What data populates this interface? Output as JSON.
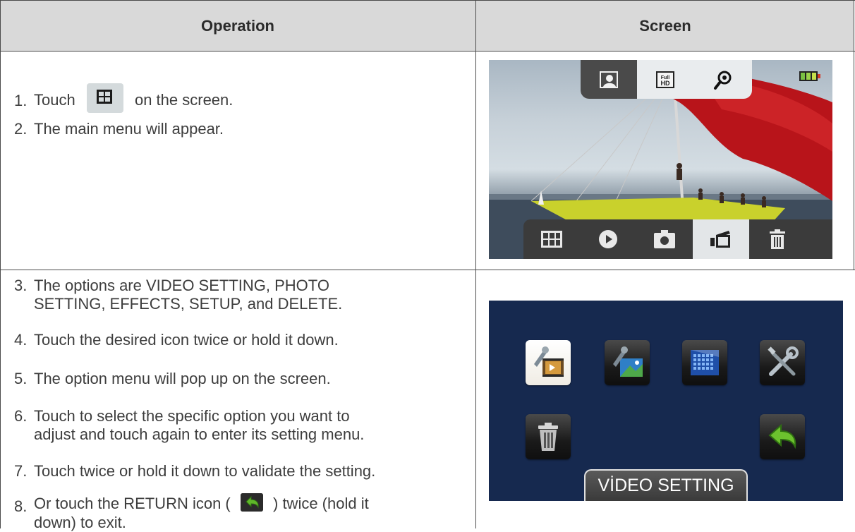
{
  "header": {
    "operation": "Operation",
    "screen": "Screen"
  },
  "steps": [
    {
      "num": "1.",
      "before": "Touch",
      "after": "on the screen."
    },
    {
      "num": "2.",
      "text": "The main menu will appear."
    },
    {
      "num": "3.",
      "line1": "The options are VIDEO SETTING, PHOTO",
      "line2": "SETTING, EFFECTS, SETUP, and DELETE."
    },
    {
      "num": "4.",
      "text": "Touch the desired icon twice or hold it down."
    },
    {
      "num": "5.",
      "text": "The option menu will pop up on the screen."
    },
    {
      "num": "6.",
      "line1": "Touch to select the specific option you want to",
      "line2": "adjust and touch again to enter its setting menu."
    },
    {
      "num": "7.",
      "text": "Touch twice or hold it down to validate the setting."
    },
    {
      "num": "8.",
      "before": "Or touch the RETURN icon (",
      "after": ") twice (hold it",
      "line2": "down) to exit."
    }
  ],
  "menu_screen": {
    "selected_label": "VİDEO SETTING"
  },
  "colors": {
    "header_bg": "#d9d9d9",
    "menu_bg": "#16294f",
    "sail": "#c0161a",
    "hull": "#c9d12c"
  },
  "icons": {
    "top_bar": [
      "face-mode-icon",
      "hd-icon",
      "stabilization-icon"
    ],
    "bottom_bar": [
      "menu-grid-icon",
      "play-icon",
      "camera-icon",
      "video-icon",
      "trash-icon"
    ],
    "menu": [
      "video-setting-icon",
      "photo-setting-icon",
      "effects-icon",
      "setup-icon",
      "delete-icon",
      "return-icon"
    ]
  }
}
